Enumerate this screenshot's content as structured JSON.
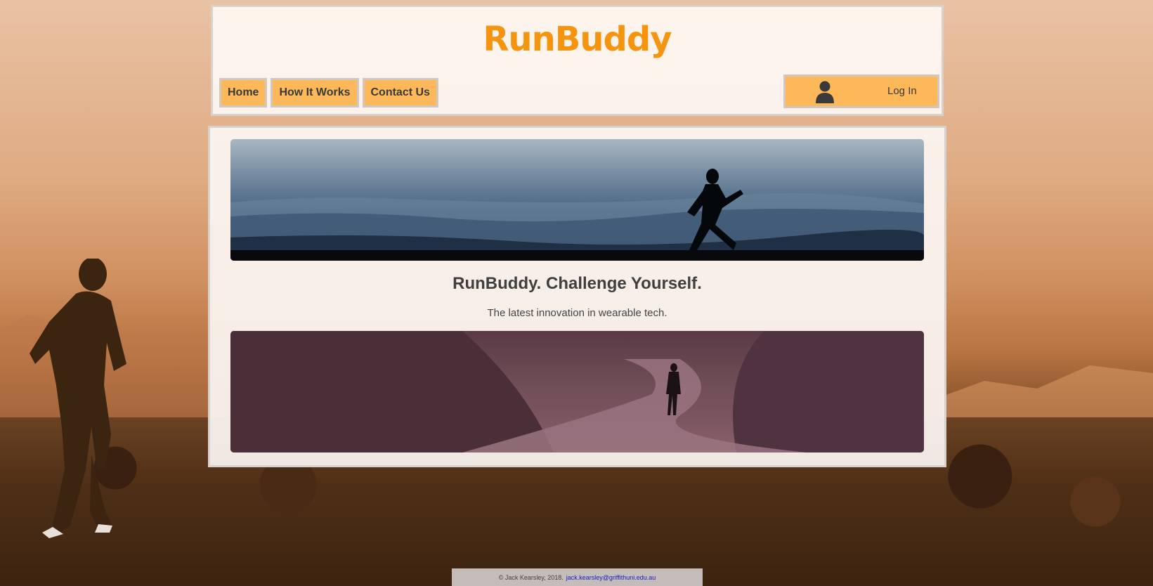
{
  "site": {
    "logo": "RunBuddy"
  },
  "nav": {
    "items": [
      {
        "label": "Home"
      },
      {
        "label": "How It Works"
      },
      {
        "label": "Contact Us"
      }
    ],
    "login_label": "Log In",
    "login_icon": "user-icon"
  },
  "main": {
    "tagline": "RunBuddy. Challenge Yourself.",
    "subtext": "The latest innovation in wearable tech."
  },
  "footer": {
    "copyright": "© Jack Kearsley, 2018.",
    "email": "jack.kearsley@griffithuni.edu.au"
  },
  "colors": {
    "accent": "#f5940f",
    "button": "#fdb85a"
  }
}
